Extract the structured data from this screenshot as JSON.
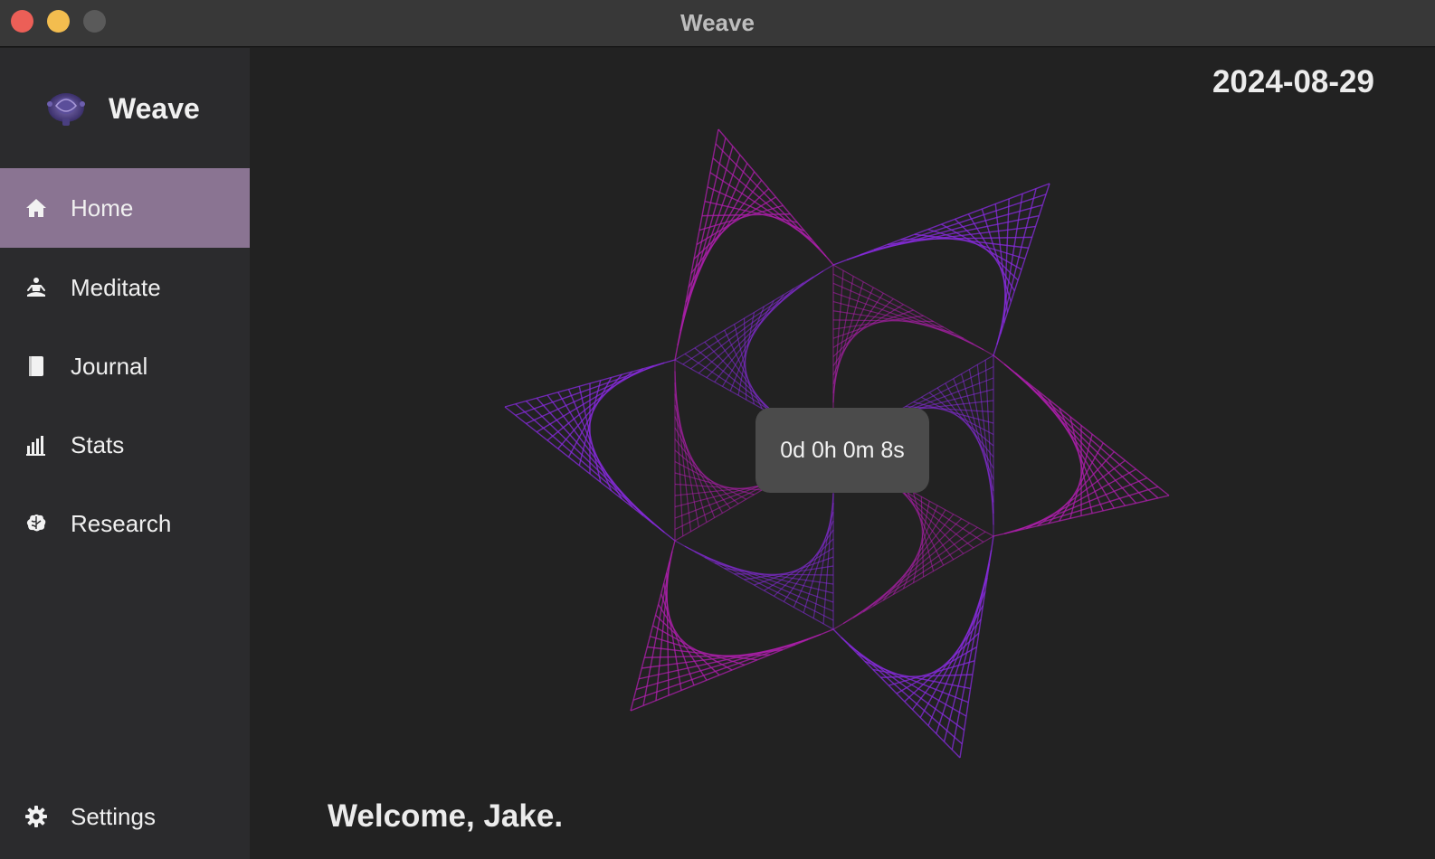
{
  "window": {
    "title": "Weave"
  },
  "sidebar": {
    "brand": "Weave",
    "items": [
      {
        "label": "Home",
        "icon": "home-icon",
        "active": true
      },
      {
        "label": "Meditate",
        "icon": "meditate-icon",
        "active": false
      },
      {
        "label": "Journal",
        "icon": "journal-icon",
        "active": false
      },
      {
        "label": "Stats",
        "icon": "stats-icon",
        "active": false
      },
      {
        "label": "Research",
        "icon": "brain-icon",
        "active": false
      }
    ],
    "settings": {
      "label": "Settings",
      "icon": "gear-icon"
    }
  },
  "main": {
    "date": "2024-08-29",
    "timer": "0d 0h 0m 8s",
    "welcome": "Welcome, Jake."
  },
  "colors": {
    "accent": "#8a7492",
    "pattern_purple": "#8a2be2",
    "pattern_magenta": "#b21fb0"
  }
}
